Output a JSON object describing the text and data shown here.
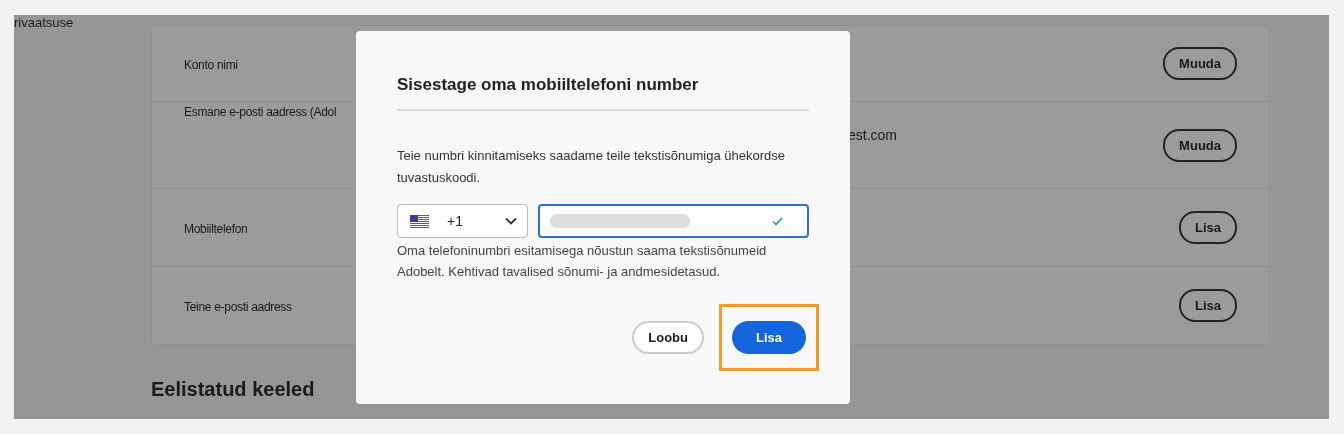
{
  "page": {
    "breadcrumb": "rivaatsuse",
    "rows": [
      {
        "label": "Konto nimi",
        "value": "",
        "action": "Muuda"
      },
      {
        "label": "Esmane e-posti aadress (Adol",
        "value": "est.com",
        "action": "Muuda"
      },
      {
        "label": "Mobiiltelefon",
        "value": "",
        "action": "Lisa"
      },
      {
        "label": "Teine e-posti aadress",
        "value": "",
        "action": "Lisa"
      }
    ],
    "section_title": "Eelistatud keeled"
  },
  "dialog": {
    "title": "Sisestage oma mobiiltelefoni number",
    "description": "Teie numbri kinnitamiseks saadame teile tekstisõnumiga ühekordse tuvastuskoodi.",
    "country_code": "+1",
    "phone_valid": true,
    "disclaimer": "Oma telefoninumbri esitamisega nõustun saama tekstisõnumeid Adobelt. Kehtivad tavalised sõnumi- ja andmesidetasud.",
    "buttons": [
      {
        "label": "Loobu",
        "kind": "secondary",
        "highlighted": false
      },
      {
        "label": "Lisa",
        "kind": "primary",
        "highlighted": true
      }
    ]
  }
}
